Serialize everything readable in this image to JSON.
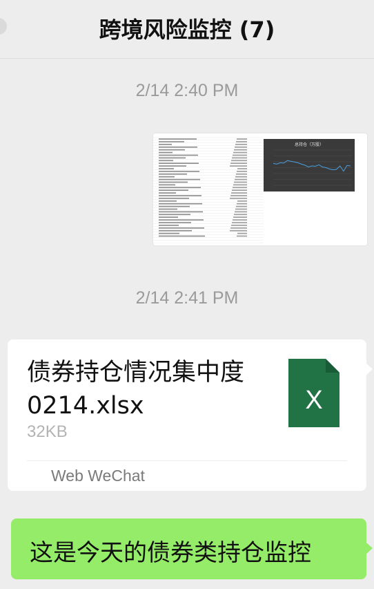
{
  "header": {
    "title": "跨境风险监控 (7)"
  },
  "messages": {
    "time1": "2/14 2:40 PM",
    "time2": "2/14 2:41 PM",
    "image": {
      "chart_title": "总持仓（万股）",
      "chart_data": {
        "type": "line",
        "title": "总持仓（万股）",
        "values": [
          0.62,
          0.6,
          0.64,
          0.63,
          0.7,
          0.68,
          0.66,
          0.64,
          0.6,
          0.57,
          0.52,
          0.55,
          0.54,
          0.58,
          0.52,
          0.5,
          0.46,
          0.44,
          0.45,
          0.55,
          0.4,
          0.56,
          0.55
        ]
      }
    },
    "file": {
      "name": "债券持仓情况集中度 0214.xlsx",
      "size": "32KB",
      "source": "Web WeChat",
      "icon": "excel-file-icon",
      "icon_letter": "X",
      "icon_color": "#217346"
    },
    "text_message": "这是今天的债券类持仓监控"
  },
  "colors": {
    "background": "#ededed",
    "outgoing_bubble": "#95ec69",
    "card": "#ffffff",
    "time_text": "#9a9a9a"
  }
}
